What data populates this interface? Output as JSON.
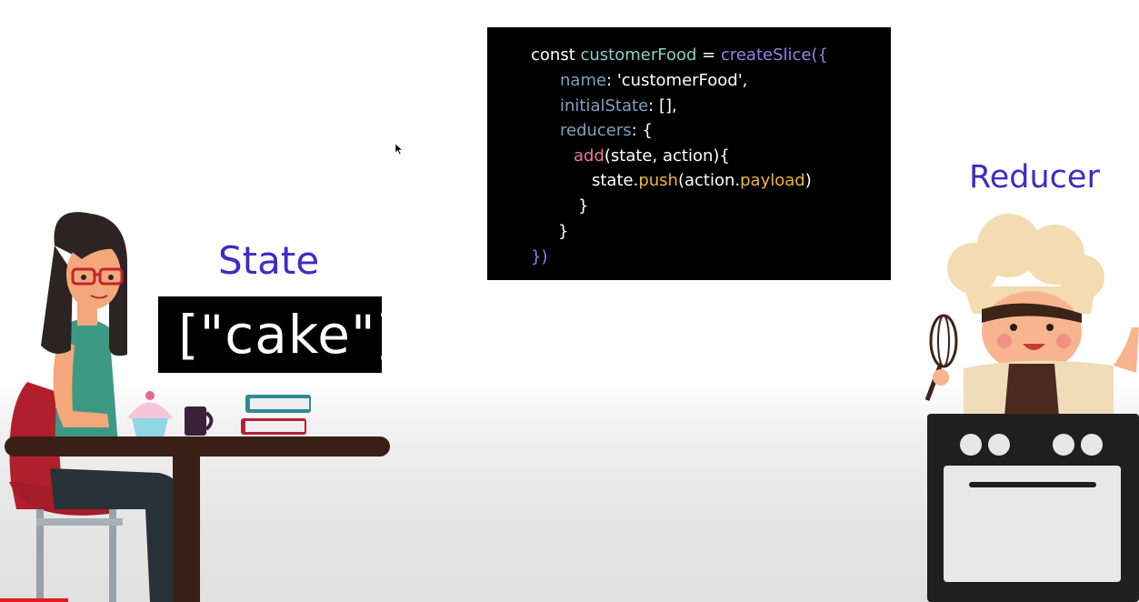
{
  "code": {
    "lines": [
      [
        {
          "t": "const ",
          "c": "text"
        },
        {
          "t": "customerFood",
          "c": "var"
        },
        {
          "t": " = ",
          "c": "text"
        },
        {
          "t": "createSlice({",
          "c": "func"
        }
      ],
      [
        {
          "t": "name",
          "c": "prop"
        },
        {
          "t": ": 'customerFood',",
          "c": "text"
        }
      ],
      [
        {
          "t": "initialState",
          "c": "prop"
        },
        {
          "t": ": [],",
          "c": "text"
        }
      ],
      [
        {
          "t": "reducers",
          "c": "prop"
        },
        {
          "t": ": {",
          "c": "text"
        }
      ],
      [
        {
          "t": "add",
          "c": "method"
        },
        {
          "t": "(state, action){",
          "c": "text"
        }
      ],
      [
        {
          "t": "state.",
          "c": "text"
        },
        {
          "t": "push",
          "c": "yellow"
        },
        {
          "t": "(action.",
          "c": "text"
        },
        {
          "t": "payload",
          "c": "yellow"
        },
        {
          "t": ")",
          "c": "text"
        }
      ],
      [
        {
          "t": "}",
          "c": "text"
        }
      ],
      [
        {
          "t": "}",
          "c": "text"
        }
      ],
      [
        {
          "t": "})",
          "c": "func"
        }
      ]
    ]
  },
  "labels": {
    "state": "State",
    "reducer": "Reducer"
  },
  "state_value": "[\"cake\"]",
  "colors": {
    "accent": "#3f2bc4",
    "code_bg": "#000000",
    "progress": "#e21c1c"
  }
}
